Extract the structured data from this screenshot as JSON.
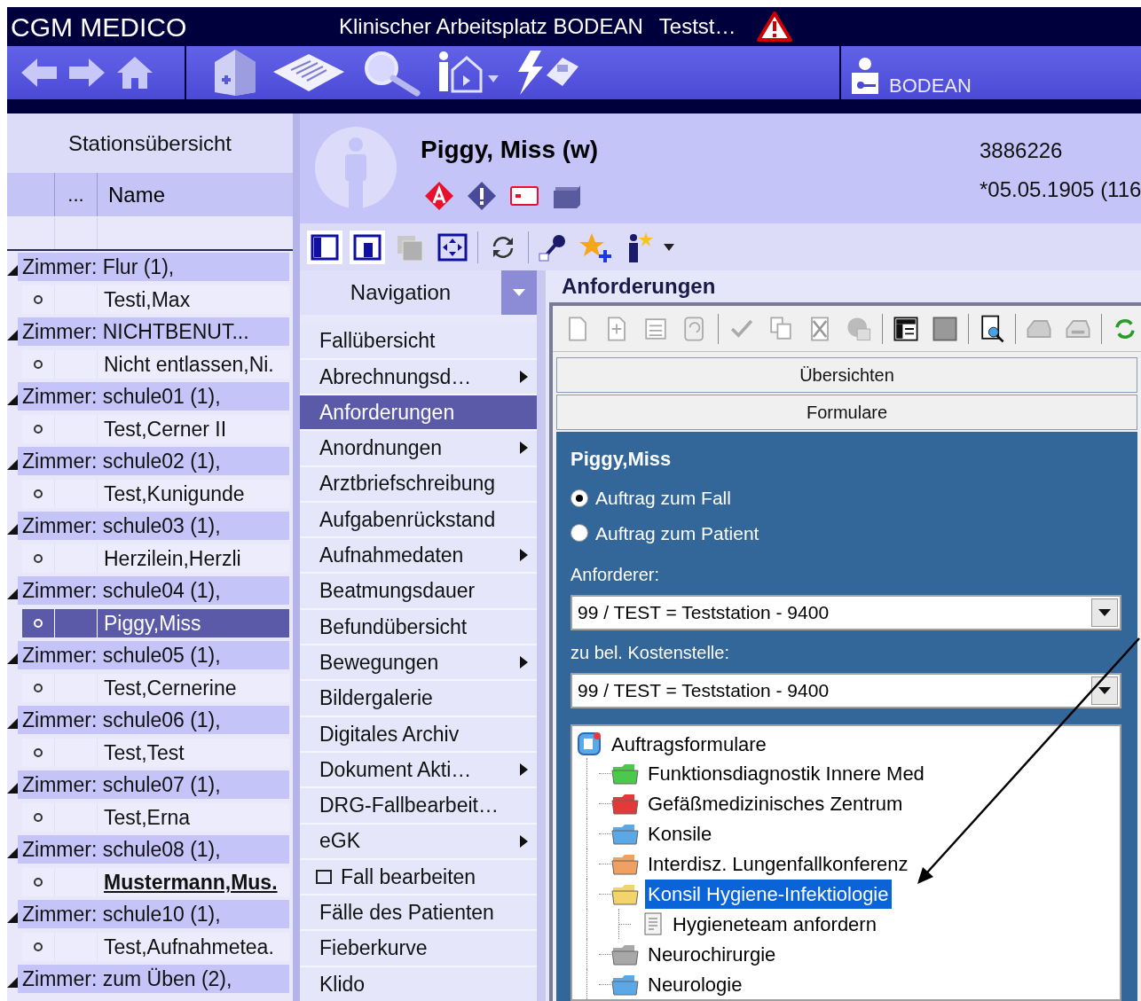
{
  "app": {
    "brand": "CGM MEDICO",
    "title": "Klinischer Arbeitsplatz BODEAN",
    "station": "Testst…",
    "user": "BODEAN"
  },
  "station_overview": {
    "title": "Stationsübersicht",
    "columns": [
      "...",
      "Name"
    ],
    "rows": [
      {
        "kind": "room",
        "label": "Zimmer: Flur (1),"
      },
      {
        "kind": "patient",
        "label": "Testi,Max",
        "selected": false,
        "emphasized": false
      },
      {
        "kind": "room",
        "label": "Zimmer: NICHTBENUT..."
      },
      {
        "kind": "patient",
        "label": "Nicht entlassen,Ni.",
        "selected": false,
        "emphasized": false
      },
      {
        "kind": "room",
        "label": "Zimmer: schule01 (1),"
      },
      {
        "kind": "patient",
        "label": "Test,Cerner II",
        "selected": false,
        "emphasized": false
      },
      {
        "kind": "room",
        "label": "Zimmer: schule02 (1),"
      },
      {
        "kind": "patient",
        "label": "Test,Kunigunde",
        "selected": false,
        "emphasized": false
      },
      {
        "kind": "room",
        "label": "Zimmer: schule03 (1),"
      },
      {
        "kind": "patient",
        "label": "Herzilein,Herzli",
        "selected": false,
        "emphasized": false
      },
      {
        "kind": "room",
        "label": "Zimmer: schule04 (1),"
      },
      {
        "kind": "patient",
        "label": "Piggy,Miss",
        "selected": true,
        "emphasized": false
      },
      {
        "kind": "room",
        "label": "Zimmer: schule05 (1),"
      },
      {
        "kind": "patient",
        "label": "Test,Cernerine",
        "selected": false,
        "emphasized": false
      },
      {
        "kind": "room",
        "label": "Zimmer: schule06 (1),"
      },
      {
        "kind": "patient",
        "label": "Test,Test",
        "selected": false,
        "emphasized": false
      },
      {
        "kind": "room",
        "label": "Zimmer: schule07 (1),"
      },
      {
        "kind": "patient",
        "label": "Test,Erna",
        "selected": false,
        "emphasized": false
      },
      {
        "kind": "room",
        "label": "Zimmer: schule08 (1),"
      },
      {
        "kind": "patient",
        "label": "Mustermann,Mus.",
        "selected": false,
        "emphasized": true
      },
      {
        "kind": "room",
        "label": "Zimmer: schule10 (1),"
      },
      {
        "kind": "patient",
        "label": "Test,Aufnahmetea.",
        "selected": false,
        "emphasized": false
      },
      {
        "kind": "room",
        "label": "Zimmer: zum Üben (2),"
      }
    ]
  },
  "patient": {
    "name": "Piggy, Miss (w)",
    "id": "3886226",
    "birth": "*05.05.1905 (116"
  },
  "navigation": {
    "title": "Navigation",
    "items": [
      {
        "label": "Fallübersicht",
        "submenu": false,
        "selected": false
      },
      {
        "label": "Abrechnungsd…",
        "submenu": true,
        "selected": false
      },
      {
        "label": "Anforderungen",
        "submenu": false,
        "selected": true
      },
      {
        "label": "Anordnungen",
        "submenu": true,
        "selected": false
      },
      {
        "label": "Arztbriefschreibung",
        "submenu": false,
        "selected": false
      },
      {
        "label": "Aufgabenrückstand",
        "submenu": false,
        "selected": false
      },
      {
        "label": "Aufnahmedaten",
        "submenu": true,
        "selected": false
      },
      {
        "label": "Beatmungsdauer",
        "submenu": false,
        "selected": false
      },
      {
        "label": "Befundübersicht",
        "submenu": false,
        "selected": false
      },
      {
        "label": "Bewegungen",
        "submenu": true,
        "selected": false
      },
      {
        "label": "Bildergalerie",
        "submenu": false,
        "selected": false
      },
      {
        "label": "Digitales Archiv",
        "submenu": false,
        "selected": false
      },
      {
        "label": "Dokument Akti…",
        "submenu": true,
        "selected": false
      },
      {
        "label": "DRG-Fallbearbeit…",
        "submenu": false,
        "selected": false
      },
      {
        "label": "eGK",
        "submenu": true,
        "selected": false
      },
      {
        "label": "Fall bearbeiten",
        "submenu": false,
        "selected": false,
        "icon": true
      },
      {
        "label": "Fälle des Patienten",
        "submenu": false,
        "selected": false
      },
      {
        "label": "Fieberkurve",
        "submenu": false,
        "selected": false
      },
      {
        "label": "Klido",
        "submenu": false,
        "selected": false
      }
    ]
  },
  "content": {
    "title": "Anforderungen",
    "sections": [
      "Übersichten",
      "Formulare"
    ],
    "form": {
      "patient": "Piggy,Miss",
      "radios": [
        {
          "label": "Auftrag zum Fall",
          "selected": true
        },
        {
          "label": "Auftrag zum Patient",
          "selected": false
        }
      ],
      "fields": [
        {
          "label": "Anforderer:",
          "value": "99 / TEST = Teststation - 9400"
        },
        {
          "label": "zu bel. Kostenstelle:",
          "value": "99 / TEST = Teststation - 9400"
        }
      ],
      "tree": {
        "label": "Auftragsformulare",
        "children": [
          {
            "label": "Funktionsdiagnostik Innere Med",
            "color": "#4cc94c",
            "selected": false
          },
          {
            "label": "Gefäßmedizinisches Zentrum",
            "color": "#e23a3a",
            "selected": false
          },
          {
            "label": "Konsile",
            "color": "#5ba8e8",
            "selected": false
          },
          {
            "label": "Interdisz. Lungenfallkonferenz",
            "color": "#f0a060",
            "selected": false
          },
          {
            "label": "Konsil Hygiene-Infektiologie",
            "color": "#f2d46a",
            "selected": true,
            "children": [
              {
                "label": "Hygieneteam anfordern",
                "selected": false
              }
            ]
          },
          {
            "label": "Neurochirurgie",
            "color": "#a8a8a8",
            "selected": false
          },
          {
            "label": "Neurologie",
            "color": "#5ba8e8",
            "selected": false
          }
        ]
      }
    }
  }
}
